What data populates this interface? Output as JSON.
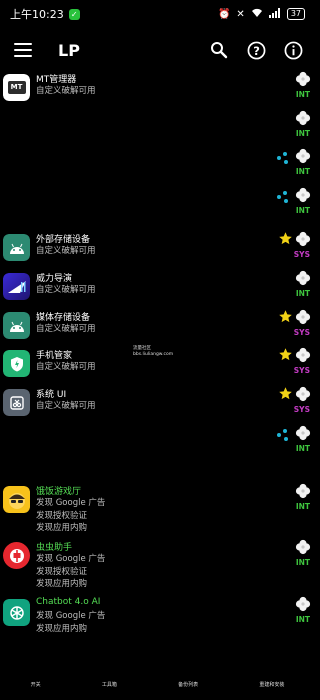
{
  "status_bar": {
    "time": "上午10:23",
    "battery": "37"
  },
  "app_bar": {
    "title": "LP"
  },
  "apps": [
    {
      "name": "MT管理器",
      "name_color": "#ffffff",
      "lines": [
        "自定义破解可用"
      ],
      "icon": "mt-manager-icon",
      "tag": "INT",
      "extras": []
    },
    {
      "name": "",
      "name_color": "#ffffff",
      "lines": [],
      "icon": "",
      "tag": "INT",
      "extras": []
    },
    {
      "name": "",
      "name_color": "#ffffff",
      "lines": [],
      "icon": "",
      "tag": "INT",
      "extras": [
        "dots"
      ]
    },
    {
      "name": "",
      "name_color": "#ffffff",
      "lines": [],
      "icon": "",
      "tag": "INT",
      "extras": [
        "dots"
      ]
    },
    {
      "name": "外部存储设备",
      "name_color": "#ffffff",
      "lines": [
        "自定义破解可用"
      ],
      "icon": "android-icon",
      "tag": "SYS",
      "extras": [
        "star"
      ]
    },
    {
      "name": "威力导演",
      "name_color": "#ffffff",
      "lines": [
        "自定义破解可用"
      ],
      "icon": "powerdirector-icon",
      "tag": "INT",
      "extras": []
    },
    {
      "name": "媒体存储设备",
      "name_color": "#ffffff",
      "lines": [
        "自定义破解可用"
      ],
      "icon": "android-icon",
      "tag": "SYS",
      "extras": [
        "star"
      ]
    },
    {
      "name": "手机管家",
      "name_color": "#ffffff",
      "lines": [
        "自定义破解可用"
      ],
      "icon": "phone-manager-icon",
      "tag": "SYS",
      "extras": [
        "star"
      ]
    },
    {
      "name": "系统 UI",
      "name_color": "#ffffff",
      "lines": [
        "自定义破解可用"
      ],
      "icon": "system-ui-icon",
      "tag": "SYS",
      "extras": [
        "star"
      ]
    },
    {
      "name": "",
      "name_color": "#ffffff",
      "lines": [],
      "icon": "",
      "tag": "INT",
      "extras": [
        "dots"
      ]
    },
    {
      "name": "饿饭游戏厅",
      "name_color": "#55dd55",
      "lines": [
        "发现 Google 广告",
        "发现授权验证",
        "发现应用内购"
      ],
      "icon": "game-hall-icon",
      "tag": "INT",
      "extras": []
    },
    {
      "name": "虫虫助手",
      "name_color": "#55dd55",
      "lines": [
        "发现 Google 广告",
        "发现授权验证",
        "发现应用内购"
      ],
      "icon": "bug-helper-icon",
      "tag": "INT",
      "extras": []
    },
    {
      "name": "Chatbot 4.o AI",
      "name_color": "#55dd55",
      "lines": [
        "发现 Google 广告",
        "发现应用内购"
      ],
      "icon": "chatbot-icon",
      "tag": "INT",
      "extras": []
    }
  ],
  "watermark": {
    "line1": "流量社区",
    "line2": "bbs.liuliangw.com"
  },
  "bottom_nav": [
    "开关",
    "工具箱",
    "备份列表",
    "重建和安装"
  ]
}
